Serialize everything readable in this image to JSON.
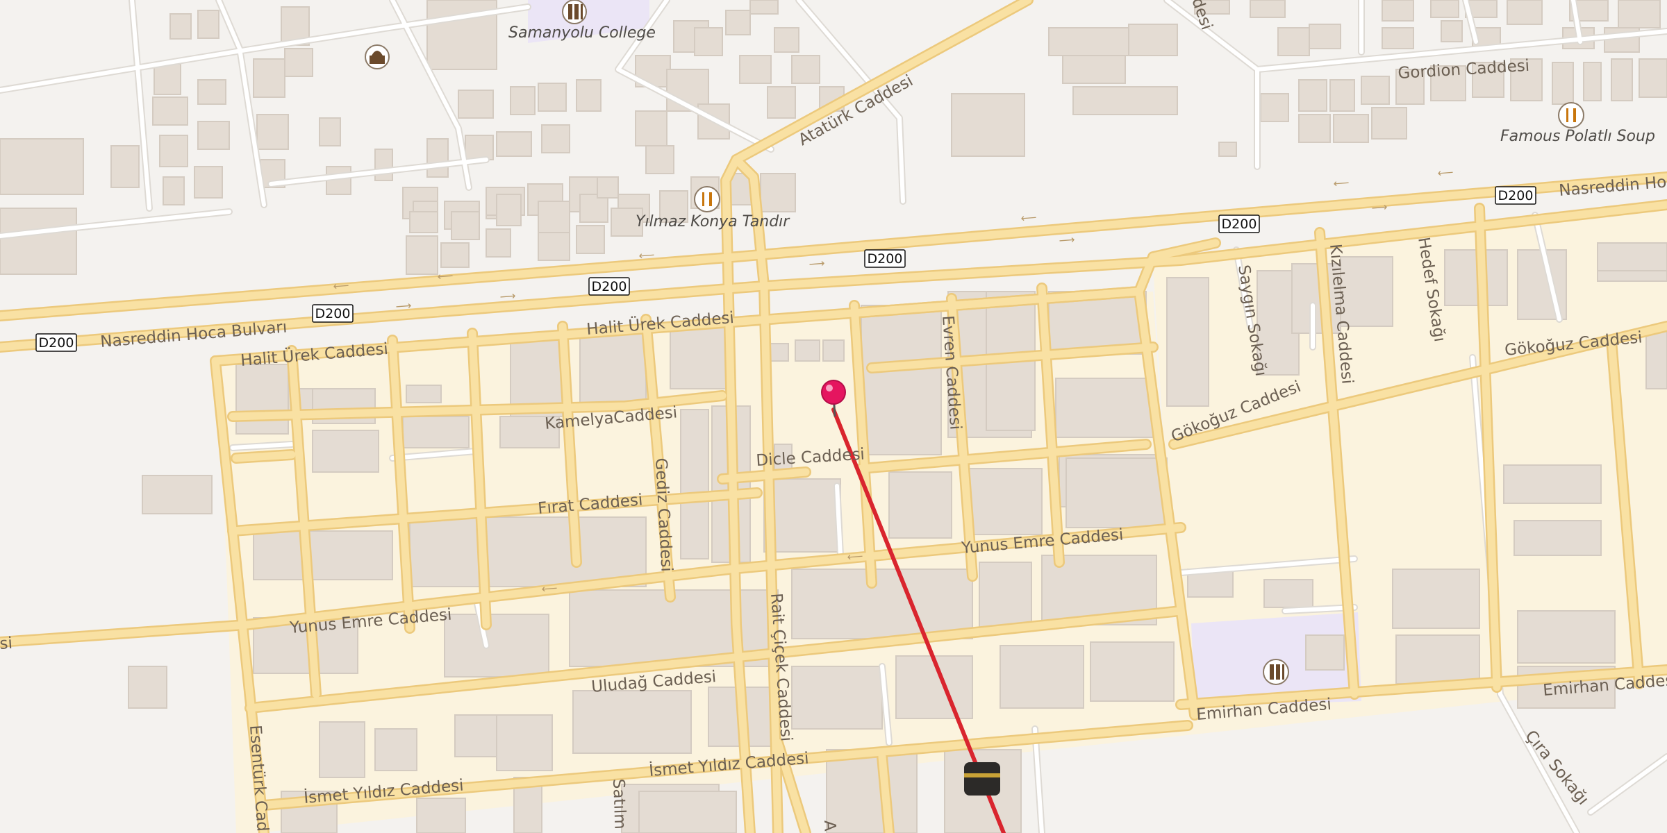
{
  "map": {
    "colors": {
      "background": "#f4f2ef",
      "residential": "#fbf3de",
      "road_casing": "#ecc97c",
      "road_fill": "#f9e1a3",
      "minor_road": "#ffffff",
      "minor_road_casing": "#dedad4",
      "building": "#e4dcd3",
      "building_stroke": "#d4cbc1",
      "school_area": "#ebe5f6",
      "route_line": "#d9252e",
      "pin": "#e5155f",
      "poi_icon": "#6b4a2c"
    },
    "streets": {
      "nasreddin_left": "Nasreddin Hoca Bulvarı",
      "nasreddin_right": "Nasreddin Hoca",
      "halit_urek_1": "Halit Ürek Caddesi",
      "halit_urek_2": "Halit Ürek Caddesi",
      "kamelya": "KamelyaCaddesi",
      "dicle": "Dicle Caddesi",
      "firat": "Fırat Caddesi",
      "gediz": "Gediz Caddesi",
      "evren": "Evren Caddesi",
      "yunus_emre_1": "Yunus Emre Caddesi",
      "yunus_emre_2": "Yunus Emre Caddesi",
      "ulu_dag": "Uludağ Caddesi",
      "rait_cicek": "Rait Çiçek Caddesi",
      "ismet_yildiz_1": "İsmet Yıldız Caddesi",
      "ismet_yildiz_2": "İsmet Yıldız Caddesi",
      "esenturk": "Esentürk Cad",
      "satilmis": "Satılm",
      "ataturk": "Atatürk Caddesi",
      "gordion": "Gordion Caddesi",
      "gokoguz_1": "Gökoğuz Caddesi",
      "gokoguz_2": "Gökoğuz Caddesi",
      "saygin": "Saygın Sokağı",
      "kizilelma": "Kızılelma Caddesi",
      "hedef": "Hedef Sokağı",
      "emirhan_1": "Emirhan Caddesi",
      "emirhan_2": "Emirhan Caddesi",
      "cira": "Çıra Sokağı",
      "cut_left": "si",
      "cut_top": "desi",
      "a_cut": "A"
    },
    "shields": {
      "d200_1": "D200",
      "d200_2": "D200",
      "d200_3": "D200",
      "d200_4": "D200",
      "d200_5": "D200",
      "d200_6": "D200"
    },
    "pois": [
      {
        "name": "Samanyolu College",
        "icon": "school-icon"
      },
      {
        "name": "Yılmaz Konya Tandır",
        "icon": "restaurant-icon"
      },
      {
        "name": "Famous Polatlı Soup",
        "icon": "restaurant-icon"
      }
    ],
    "unlabeled_icons": [
      "mosque-icon",
      "school-icon",
      "kaaba-icon"
    ],
    "markers": {
      "pin_icon": "location-pin-icon",
      "route": "red straight route line from pin to bottom edge"
    }
  }
}
